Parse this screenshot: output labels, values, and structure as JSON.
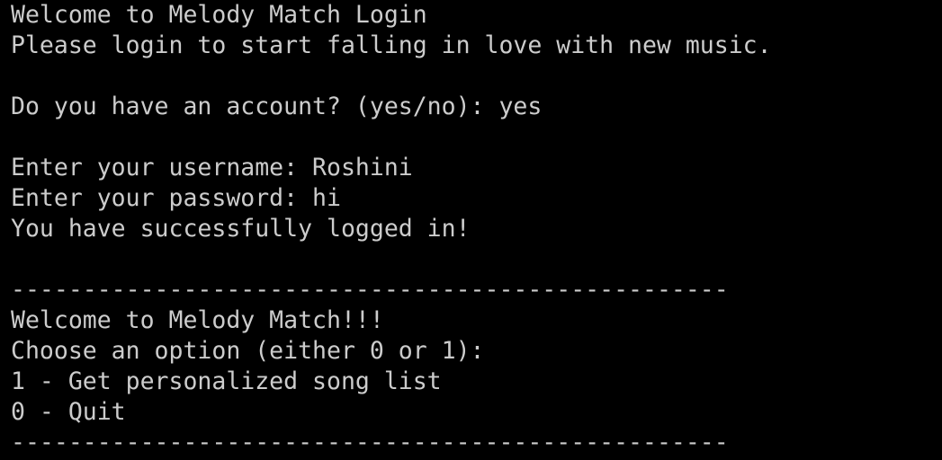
{
  "terminal": {
    "lines": [
      "Welcome to Melody Match Login",
      "Please login to start falling in love with new music.",
      "",
      "Do you have an account? (yes/no): yes",
      "",
      "Enter your username: Roshini",
      "Enter your password: hi",
      "You have successfully logged in!",
      "",
      "--------------------------------------------------",
      "Welcome to Melody Match!!!",
      "Choose an option (either 0 or 1):",
      "1 - Get personalized song list",
      "0 - Quit",
      "--------------------------------------------------"
    ]
  },
  "colors": {
    "background": "#000000",
    "text": "#cccccc"
  }
}
